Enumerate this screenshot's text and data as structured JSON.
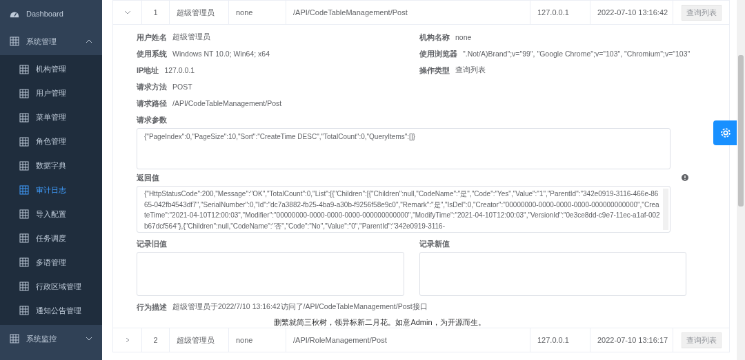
{
  "sidebar": {
    "items": [
      {
        "label": "Dashboard",
        "kind": "link",
        "selected": false
      },
      {
        "label": "系统管理",
        "kind": "group",
        "expanded": true,
        "children": [
          {
            "label": "机构管理",
            "selected": false
          },
          {
            "label": "用户管理",
            "selected": false
          },
          {
            "label": "菜单管理",
            "selected": false
          },
          {
            "label": "角色管理",
            "selected": false
          },
          {
            "label": "数据字典",
            "selected": false
          },
          {
            "label": "审计日志",
            "selected": true
          },
          {
            "label": "导入配置",
            "selected": false
          },
          {
            "label": "任务调度",
            "selected": false
          },
          {
            "label": "多语管理",
            "selected": false
          },
          {
            "label": "行政区域管理",
            "selected": false
          },
          {
            "label": "通知公告管理",
            "selected": false
          }
        ]
      },
      {
        "label": "系统监控",
        "kind": "group",
        "expanded": false
      }
    ]
  },
  "table": {
    "rows": [
      {
        "expanded": true,
        "index": "1",
        "user": "超级管理员",
        "org": "none",
        "path": "/API/CodeTableManagement/Post",
        "ip": "127.0.0.1",
        "time": "2022-07-10 13:16:42",
        "action": "查询列表",
        "detail": {
          "fields_left": [
            {
              "label": "用户姓名",
              "value": "超级管理员"
            },
            {
              "label": "使用系统",
              "value": "Windows NT 10.0; Win64; x64"
            },
            {
              "label": "IP地址",
              "value": "127.0.0.1"
            }
          ],
          "fields_right": [
            {
              "label": "机构名称",
              "value": "none"
            },
            {
              "label": "使用浏览器",
              "value": "\".Not/A)Brand\";v=\"99\", \"Google Chrome\";v=\"103\", \"Chromium\";v=\"103\""
            },
            {
              "label": "操作类型",
              "value": "查询列表"
            }
          ],
          "method": {
            "label": "请求方法",
            "value": "POST"
          },
          "request_path": {
            "label": "请求路径",
            "value": "/API/CodeTableManagement/Post"
          },
          "params": {
            "label": "请求参数",
            "value": "{\"PageIndex\":0,\"PageSize\":10,\"Sort\":\"CreateTime DESC\",\"TotalCount\":0,\"QueryItems\":[]}"
          },
          "result": {
            "label": "返回值",
            "value": "{\"HttpStatusCode\":200,\"Message\":\"OK\",\"TotalCount\":0,\"List\":[{\"Children\":[{\"Children\":null,\"CodeName\":\"是\",\"Code\":\"Yes\",\"Value\":\"1\",\"ParentId\":\"342e0919-3116-466e-8665-042fb4543df7\",\"SerialNumber\":0,\"Id\":\"dc7a3882-fb25-4ba9-a30b-f9256f58e9c0\",\"Remark\":\"是\",\"IsDel\":0,\"Creator\":\"00000000-0000-0000-0000-000000000000\",\"CreateTime\":\"2021-04-10T12:00:03\",\"Modifier\":\"00000000-0000-0000-0000-000000000000\",\"ModifyTime\":\"2021-04-10T12:00:03\",\"VersionId\":\"0e3ce8dd-c9e7-11ec-a1af-002b67dcf564\"},{\"Children\":null,\"CodeName\":\"否\",\"Code\":\"No\",\"Value\":\"0\",\"ParentId\":\"342e0919-3116-"
          },
          "old_value": {
            "label": "记录旧值"
          },
          "new_value": {
            "label": "记录新值"
          },
          "description": {
            "label": "行为描述",
            "value": "超级管理员于2022/7/10 13:16:42访问了/API/CodeTableManagement/Post接口"
          }
        }
      },
      {
        "expanded": false,
        "index": "2",
        "user": "超级管理员",
        "org": "none",
        "path": "/API/RoleManagement/Post",
        "ip": "127.0.0.1",
        "time": "2022-07-10 13:16:17",
        "action": "查询列表"
      }
    ]
  },
  "footer": "删繁就简三秋树，领异标新二月花。如意Admin，为开源而生。"
}
